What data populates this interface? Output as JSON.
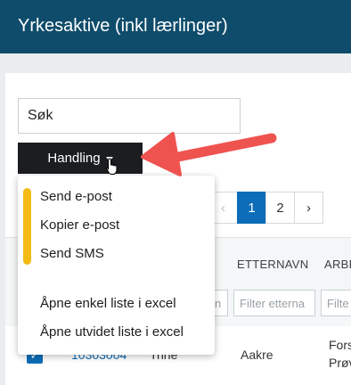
{
  "header": {
    "title": "Yrkesaktive (inkl lærlinger)"
  },
  "search": {
    "placeholder": "Søk"
  },
  "action_button": {
    "label": "Handling"
  },
  "dropdown": {
    "items": [
      "Send e-post",
      "Kopier e-post",
      "Send SMS",
      "Åpne enkel liste i excel",
      "Åpne utvidet liste i excel"
    ]
  },
  "pagination": {
    "prev": "‹",
    "pages": [
      "1",
      "2"
    ],
    "current": "1",
    "next": "›"
  },
  "table": {
    "columns": [
      "ETTERNAVN",
      "ARBE"
    ],
    "filters": [
      "n",
      "Filter etterna",
      "Filte"
    ],
    "row": {
      "id": "10303004",
      "first_name": "Trine",
      "last_name": "Aakre",
      "detail_1": "Fors",
      "detail_2": "Prøv"
    }
  },
  "colors": {
    "header": "#0f4c6b",
    "accent": "#0d6db8",
    "highlight": "#f4bb16",
    "annotation_arrow": "#ef5350"
  }
}
